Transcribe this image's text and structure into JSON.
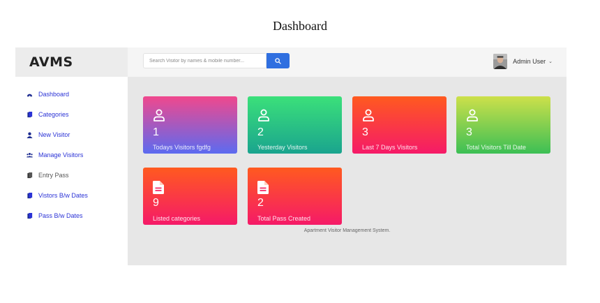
{
  "page": {
    "heading": "Dashboard"
  },
  "header": {
    "brand": "AVMS",
    "search_placeholder": "Search Visitor by names & mobile number...",
    "search_value": "",
    "user_name": "Admin User",
    "user_caret": "⌄"
  },
  "sidebar": {
    "items": [
      {
        "label": "Dashboard",
        "icon": "dashboard-icon"
      },
      {
        "label": "Categories",
        "icon": "file-icon"
      },
      {
        "label": "New Visitor",
        "icon": "user-icon"
      },
      {
        "label": "Manage Visitors",
        "icon": "users-icon"
      },
      {
        "label": "Entry Pass",
        "icon": "file-icon"
      },
      {
        "label": "Vistors B/w Dates",
        "icon": "file-icon"
      },
      {
        "label": "Pass B/w Dates",
        "icon": "file-icon"
      }
    ]
  },
  "cards": [
    {
      "count": "1",
      "label": "Todays Visitors fgdfg",
      "icon": "user-icon"
    },
    {
      "count": "2",
      "label": "Yesterday Visitors",
      "icon": "user-icon"
    },
    {
      "count": "3",
      "label": "Last 7 Days Visitors",
      "icon": "user-icon"
    },
    {
      "count": "3",
      "label": "Total Visitors Till Date",
      "icon": "user-icon"
    },
    {
      "count": "9",
      "label": "Listed categories",
      "icon": "document-icon"
    },
    {
      "count": "2",
      "label": "Total Pass Created",
      "icon": "document-icon"
    }
  ],
  "footer": {
    "text": "Apartment Visitor Management System."
  },
  "colors": {
    "nav_link": "#2b33d6",
    "search_button": "#2f6fe0",
    "content_bg": "#e7e7e7"
  }
}
